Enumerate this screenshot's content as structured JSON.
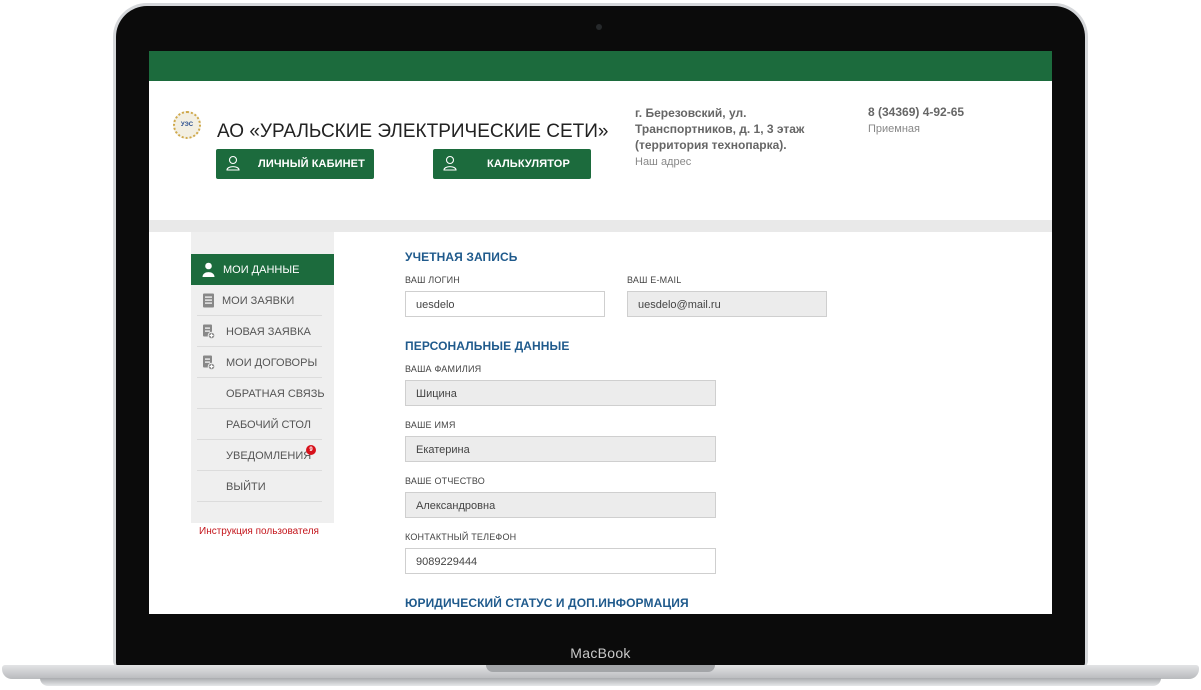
{
  "device": {
    "brand": "MacBook"
  },
  "header": {
    "logo_text": "УЭС",
    "company_name": "АО «УРАЛЬСКИЕ ЭЛЕКТРИЧЕСКИЕ СЕТИ»",
    "buttons": {
      "cabinet": "ЛИЧНЫЙ КАБИНЕТ",
      "calculator": "КАЛЬКУЛЯТОР"
    },
    "address": "г. Березовский, ул. Транспортников, д. 1, 3 этаж (территория технопарка).",
    "address_label": "Наш адрес",
    "phone": "8 (34369) 4-92-65",
    "phone_label": "Приемная"
  },
  "sidebar": {
    "items": [
      {
        "label": "МОИ ДАННЫЕ",
        "icon": "user-icon",
        "active": true
      },
      {
        "label": "МОИ ЗАЯВКИ",
        "icon": "document-icon"
      },
      {
        "label": "НОВАЯ ЗАЯВКА",
        "icon": "new-document-icon"
      },
      {
        "label": "МОИ ДОГОВОРЫ",
        "icon": "contract-icon"
      },
      {
        "label": "ОБРАТНАЯ СВЯЗЬ"
      },
      {
        "label": "РАБОЧИЙ СТОЛ"
      },
      {
        "label": "УВЕДОМЛЕНИЯ",
        "badge": "9"
      },
      {
        "label": "ВЫЙТИ"
      }
    ],
    "instructions_link": "Инструкция пользователя"
  },
  "form": {
    "account": {
      "title": "УЧЕТНАЯ ЗАПИСЬ",
      "login_label": "ВАШ ЛОГИН",
      "login_value": "uesdelo",
      "email_label": "ВАШ E-MAIL",
      "email_value": "uesdelo@mail.ru"
    },
    "personal": {
      "title": "ПЕРСОНАЛЬНЫЕ ДАННЫЕ",
      "surname_label": "ВАША ФАМИЛИЯ",
      "surname_value": "Шицина",
      "name_label": "ВАШЕ ИМЯ",
      "name_value": "Екатерина",
      "patronymic_label": "ВАШЕ ОТЧЕСТВО",
      "patronymic_value": "Александровна",
      "phone_label": "КОНТАКТНЫЙ ТЕЛЕФОН",
      "phone_value": "9089229444"
    },
    "legal": {
      "title": "ЮРИДИЧЕСКИЙ СТАТУС И ДОП.ИНФОРМАЦИЯ"
    }
  },
  "colors": {
    "brand_green": "#1c6b3d",
    "section_blue": "#1f5a8c",
    "alert_red": "#d7111b"
  }
}
